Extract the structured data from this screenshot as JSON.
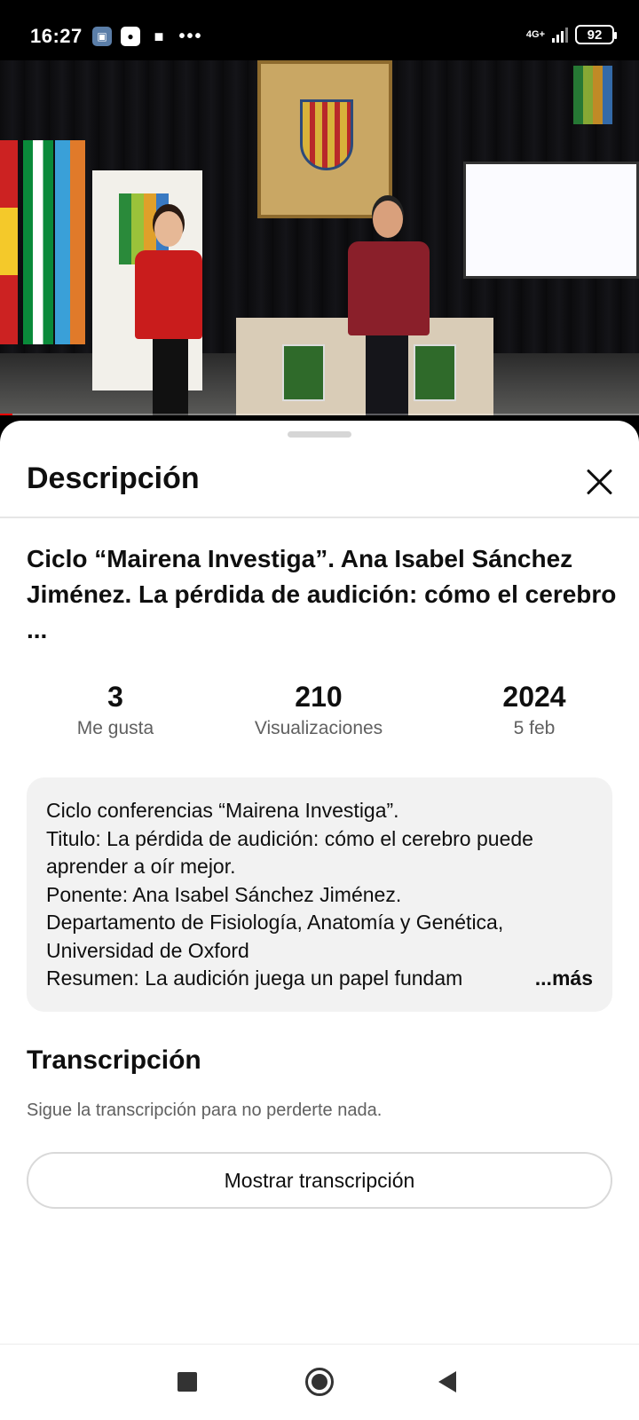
{
  "status_bar": {
    "time": "16:27",
    "network": "4G+",
    "battery": "92",
    "overflow": "•••",
    "icons": [
      "gallery-icon",
      "media-icon",
      "gamepad-icon",
      "more-icon",
      "signal-icon",
      "battery-icon"
    ]
  },
  "video": {
    "progress_fraction": 0.02,
    "accent_color": "#ff0000"
  },
  "sheet": {
    "title": "Descripción",
    "close_icon": "close-icon"
  },
  "video_title": "Ciclo “Mairena Investiga”. Ana Isabel Sánchez Jiménez. La pérdida de audición: cómo el cerebro ...",
  "stats": [
    {
      "value": "3",
      "label": "Me gusta"
    },
    {
      "value": "210",
      "label": "Visualizaciones"
    },
    {
      "value": "2024",
      "label": "5 feb"
    }
  ],
  "description": {
    "lines": [
      "Ciclo conferencias “Mairena Investiga”.",
      "Titulo: La pérdida de audición: cómo el cerebro puede",
      "aprender a oír mejor.",
      "Ponente: Ana Isabel Sánchez Jiménez.",
      "Departamento de Fisiología, Anatomía y Genética,",
      "Universidad de Oxford",
      "Resumen: La audición juega un papel fundam"
    ],
    "more_label": "...más"
  },
  "transcript": {
    "title": "Transcripción",
    "subtitle": "Sigue la transcripción para no perderte nada.",
    "button_label": "Mostrar transcripción"
  },
  "navbar": {
    "icons": [
      "recent-apps-icon",
      "home-icon",
      "back-icon"
    ]
  }
}
